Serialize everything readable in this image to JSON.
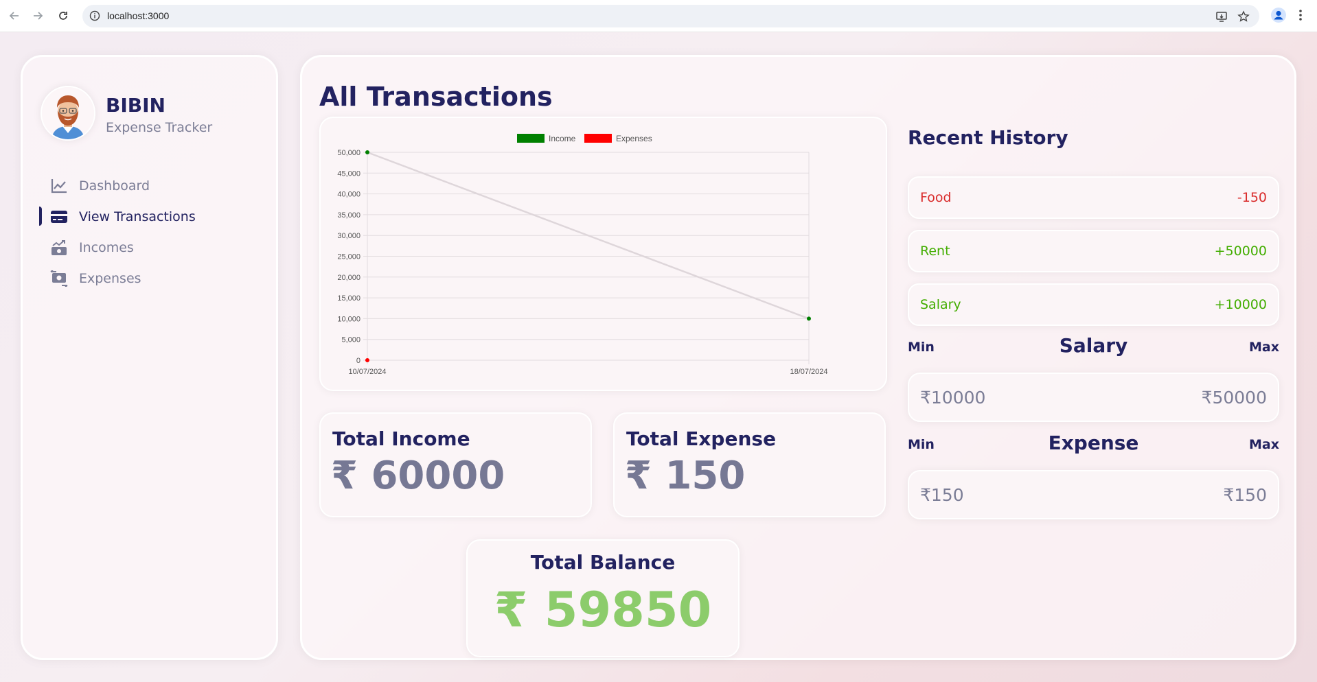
{
  "browser": {
    "url": "localhost:3000"
  },
  "sidebar": {
    "user_name": "BIBIN",
    "user_subtitle": "Expense Tracker",
    "items": [
      {
        "label": "Dashboard",
        "icon": "line-chart-icon",
        "active": false
      },
      {
        "label": "View Transactions",
        "icon": "credit-card-icon",
        "active": true
      },
      {
        "label": "Incomes",
        "icon": "money-bill-trend-icon",
        "active": false
      },
      {
        "label": "Expenses",
        "icon": "money-bill-transfer-icon",
        "active": false
      }
    ]
  },
  "main": {
    "title": "All Transactions",
    "total_income": {
      "title": "Total Income",
      "value": "₹ 60000"
    },
    "total_expense": {
      "title": "Total Expense",
      "value": "₹ 150"
    },
    "total_balance": {
      "title": "Total Balance",
      "value": "₹ 59850"
    }
  },
  "history": {
    "title": "Recent History",
    "items": [
      {
        "label": "Food",
        "amount": "-150",
        "type": "expense"
      },
      {
        "label": "Rent",
        "amount": "+50000",
        "type": "income"
      },
      {
        "label": "Salary",
        "amount": "+10000",
        "type": "income"
      }
    ]
  },
  "ranges": {
    "salary": {
      "title": "Salary",
      "min_label": "Min",
      "max_label": "Max",
      "min": "₹10000",
      "max": "₹50000"
    },
    "expense": {
      "title": "Expense",
      "min_label": "Min",
      "max_label": "Max",
      "min": "₹150",
      "max": "₹150"
    }
  },
  "colors": {
    "income": "#008000",
    "expense": "#ff0000",
    "balance": "#8ccc6b",
    "primary": "#222260"
  },
  "chart_data": {
    "type": "line",
    "x": [
      "10/07/2024",
      "18/07/2024"
    ],
    "series": [
      {
        "name": "Income",
        "values": [
          50000,
          10000
        ],
        "color": "#008000"
      },
      {
        "name": "Expenses",
        "values": [
          0,
          null
        ],
        "color": "#ff0000"
      }
    ],
    "yticks": [
      "0",
      "5,000",
      "10,000",
      "15,000",
      "20,000",
      "25,000",
      "30,000",
      "35,000",
      "40,000",
      "45,000",
      "50,000"
    ],
    "ylim": [
      0,
      50000
    ],
    "legend": "top",
    "grid": true
  }
}
